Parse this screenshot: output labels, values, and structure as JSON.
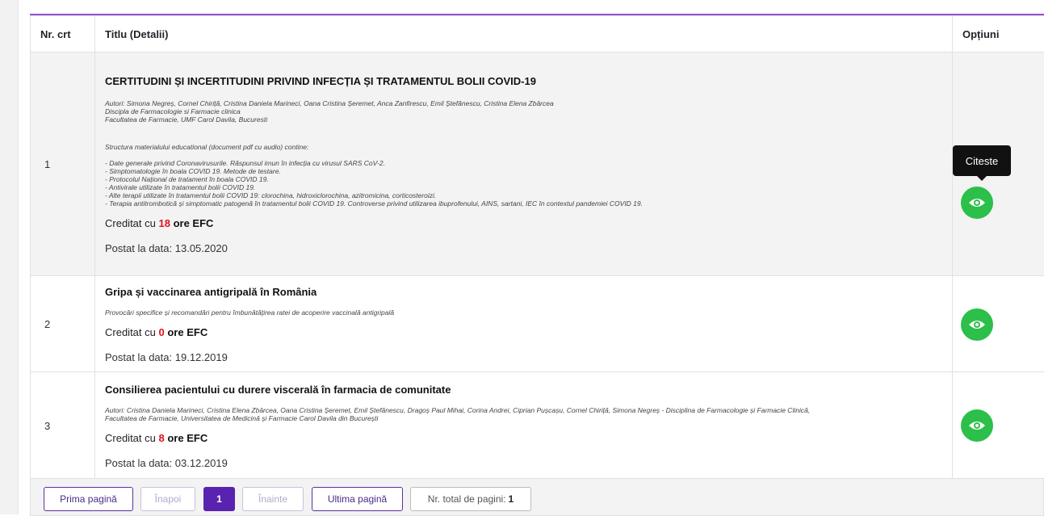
{
  "table": {
    "headers": {
      "nr": "Nr. crt",
      "title": "Titlu (Detalii)",
      "options": "Opțiuni"
    },
    "credit_prefix": "Creditat cu",
    "credit_suffix": "ore EFC",
    "posted_prefix": "Postat la data:",
    "rows": [
      {
        "nr": "1",
        "title": "CERTITUDINI ȘI INCERTITUDINI PRIVIND INFECȚIA ȘI TRATAMENTUL BOLII COVID-19",
        "authors": "Autori: Simona Negreș, Cornel Chiriță, Cristina Daniela Marineci, Oana Cristina Șeremet, Anca Zanfirescu, Emil Ștefănescu, Cristina Elena Zbârcea\nDiscipla de Farmacologie si Farmacie clinica\nFacultatea de Farmacie, UMF Carol Davila, Bucuresti",
        "structure": "Structura materialului educational (document pdf cu audio) contine:\n\n- Date generale privind Coronavirusurile. Răspunsul imun în infecția cu virusul SARS CoV-2.\n- Simptomatologie în boala COVID 19. Metode de testare.\n- Protocolul Național de tratament în boala COVID 19.\n- Antivirale utilizate în tratamentul bolii COVID 19.\n- Alte terapii utilizate în tratamentul bolii COVID 19: clorochina, hidroxiclorochina, azitromicina, corticosteroizi.\n- Terapia antitrombotică și simptomatic patogenă în tratamentul bolii COVID 19. Controverse privind utilizarea ibuprofenului, AINS, sartani, IEC în contextul pandemiei COVID 19.",
        "hours": "18",
        "date": "13.05.2020"
      },
      {
        "nr": "2",
        "title": "Gripa și vaccinarea antigripală în România",
        "authors": "Provocări specifice și recomandări pentru îmbunătățirea ratei de acoperire vaccinală antigripală",
        "hours": "0",
        "date": "19.12.2019"
      },
      {
        "nr": "3",
        "title": "Consilierea pacientului cu durere viscerală în farmacia de comunitate",
        "authors": "Autori: Cristina Daniela Marineci, Cristina Elena Zbârcea, Oana Cristina Șeremet, Emil Ștefănescu, Dragoș Paul Mihai, Corina Andrei, Ciprian Pușcașu, Cornel Chiriță, Simona Negreș - Disciplina de Farmacologie și Farmacie Clinică,\nFacultatea de Farmacie, Universitatea de Medicină și Farmacie Carol Davila din București",
        "hours": "8",
        "date": "03.12.2019"
      }
    ]
  },
  "tooltip": "Citeste",
  "icon": "eye-icon",
  "colors": {
    "accent": "#9b4fd0",
    "eye_button": "#2cbf4a",
    "hours": "#e0131a",
    "pager_active": "#5a22b0"
  },
  "pagination": {
    "first": "Prima pagină",
    "prev": "Înapoi",
    "current": "1",
    "next": "Înainte",
    "last": "Ultima pagină",
    "total_label": "Nr. total de pagini:",
    "total": "1"
  }
}
